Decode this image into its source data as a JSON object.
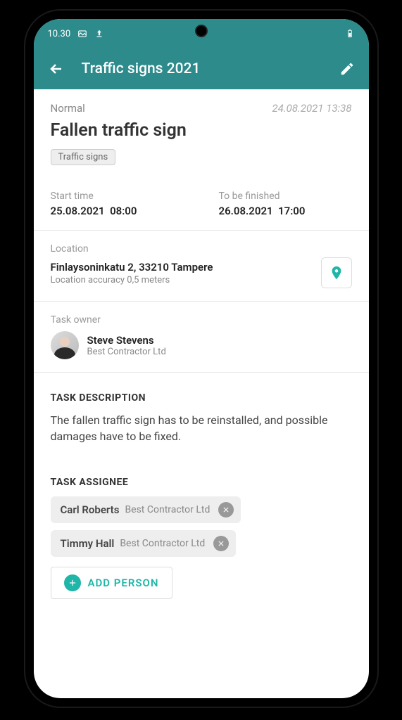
{
  "status_bar": {
    "time": "10.30"
  },
  "header": {
    "title": "Traffic signs 2021"
  },
  "task": {
    "priority": "Normal",
    "created_at": "24.08.2021 13:38",
    "title": "Fallen traffic sign",
    "tag": "Traffic signs",
    "start": {
      "label": "Start time",
      "date": "25.08.2021",
      "time": "08:00"
    },
    "finish": {
      "label": "To be finished",
      "date": "26.08.2021",
      "time": "17:00"
    }
  },
  "location": {
    "label": "Location",
    "address": "Finlaysoninkatu 2, 33210 Tampere",
    "accuracy": "Location accuracy 0,5 meters"
  },
  "owner": {
    "label": "Task owner",
    "name": "Steve Stevens",
    "company": "Best Contractor Ltd"
  },
  "description": {
    "heading": "TASK DESCRIPTION",
    "text": "The fallen traffic sign has to be reinstalled, and possible damages have to be fixed."
  },
  "assignees": {
    "heading": "TASK ASSIGNEE",
    "list": [
      {
        "name": "Carl Roberts",
        "company": "Best Contractor Ltd"
      },
      {
        "name": "Timmy Hall",
        "company": "Best Contractor Ltd"
      }
    ],
    "add_label": "ADD PERSON"
  }
}
